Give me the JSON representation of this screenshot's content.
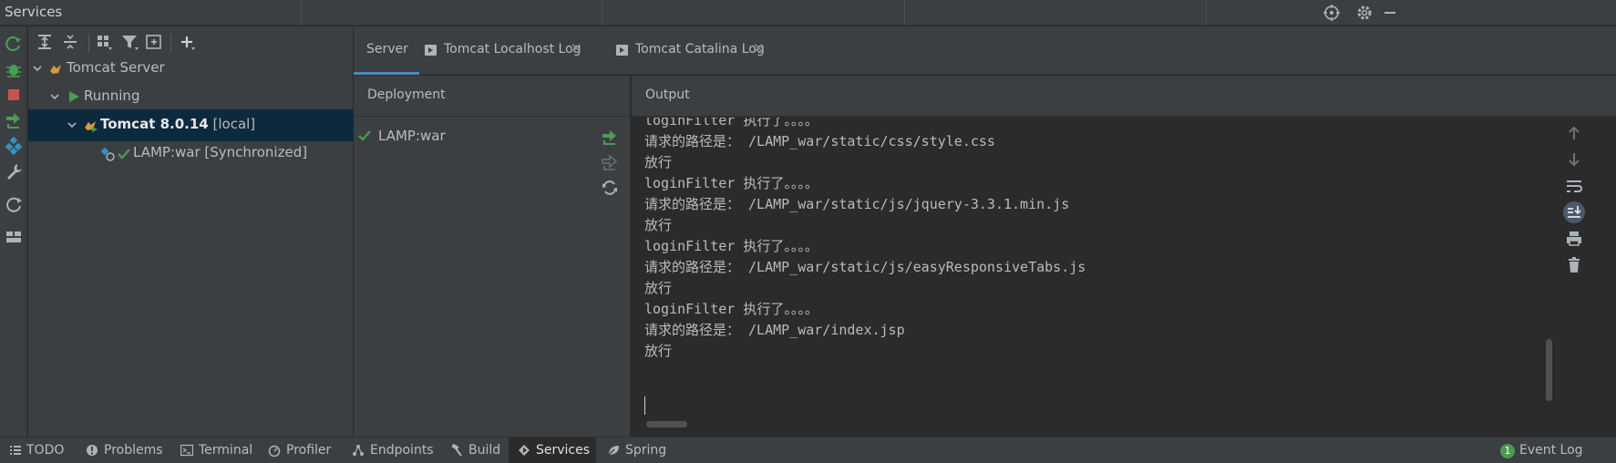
{
  "window": {
    "title": "Services"
  },
  "tree": {
    "items": [
      {
        "label": "Tomcat Server"
      },
      {
        "label": "Running"
      },
      {
        "name": "Tomcat 8.0.14",
        "suffix": " [local]"
      },
      {
        "label": "LAMP:war [Synchronized]"
      }
    ]
  },
  "tabs": [
    {
      "label": "Server",
      "active": true
    },
    {
      "label": "Tomcat Localhost Log"
    },
    {
      "label": "Tomcat Catalina Log"
    }
  ],
  "deployment": {
    "header": "Deployment",
    "item": "LAMP:war"
  },
  "output": {
    "header": "Output",
    "lines": [
      "loginFilter 执行了。。。。",
      "请求的路径是： /LAMP_war/static/css/style.css",
      "放行",
      "loginFilter 执行了。。。。",
      "请求的路径是： /LAMP_war/static/js/jquery-3.3.1.min.js",
      "放行",
      "loginFilter 执行了。。。。",
      "请求的路径是： /LAMP_war/static/js/easyResponsiveTabs.js",
      "放行",
      "loginFilter 执行了。。。。",
      "请求的路径是： /LAMP_war/index.jsp",
      "放行"
    ]
  },
  "statusbar": {
    "items": [
      {
        "label": "TODO",
        "icon": "list-icon"
      },
      {
        "label": "Problems",
        "icon": "problems-icon"
      },
      {
        "label": "Terminal",
        "icon": "terminal-icon"
      },
      {
        "label": "Profiler",
        "icon": "profiler-icon"
      },
      {
        "label": "Endpoints",
        "icon": "endpoints-icon"
      },
      {
        "label": "Build",
        "icon": "hammer-icon"
      },
      {
        "label": "Services",
        "icon": "services-icon",
        "active": true
      },
      {
        "label": "Spring",
        "icon": "spring-icon"
      }
    ],
    "event_log": {
      "label": "Event Log",
      "count": "1"
    }
  },
  "colors": {
    "accent": "#4a88c7",
    "green": "#499c54",
    "red": "#c75450",
    "selection": "#0d293e"
  }
}
